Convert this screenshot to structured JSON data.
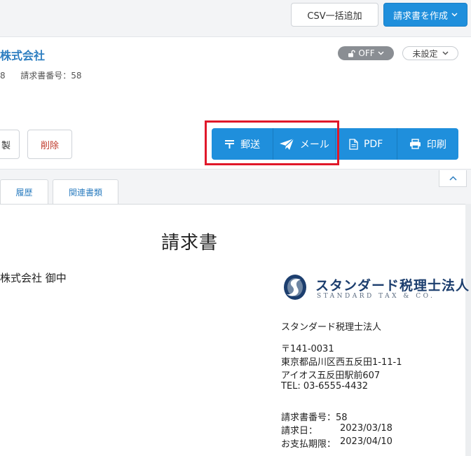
{
  "toolbar": {
    "csv_button": "CSV一括追加",
    "create_invoice_button": "請求書を作成"
  },
  "invoice_header": {
    "company_name": "株式会社",
    "meta_left": "8",
    "invoice_number_label": "請求書番号：58",
    "lock_status": "OFF",
    "status_select": "未設定",
    "left_button_partial": "製",
    "delete_button": "削除"
  },
  "actions": {
    "mail_post": "郵送",
    "email": "メール",
    "pdf": "PDF",
    "print": "印刷"
  },
  "tabs": [
    {
      "label": "履歴"
    },
    {
      "label": "関連書類"
    }
  ],
  "document": {
    "title": "請求書",
    "recipient": "株式会社 御中",
    "logo": {
      "name": "スタンダード税理士法人",
      "sub": "STANDARD TAX & CO."
    },
    "issuer": {
      "name": "スタンダード税理士法人",
      "postal": "〒141-0031",
      "address1": "東京都品川区西五反田1-11-1",
      "address2": "アイオス五反田駅前607",
      "tel": "TEL: 03-6555-4432"
    },
    "details": {
      "invoice_number": "請求書番号：58",
      "invoice_date_label": "請求日：",
      "invoice_date": "2023/03/18",
      "due_date_label": "お支払期限：",
      "due_date": "2023/04/10"
    }
  },
  "colors": {
    "primary": "#1f8fdc",
    "link": "#2f7fc1",
    "danger": "#c0392b",
    "highlight": "#e0182a",
    "logo_navy": "#1c3e6e"
  }
}
